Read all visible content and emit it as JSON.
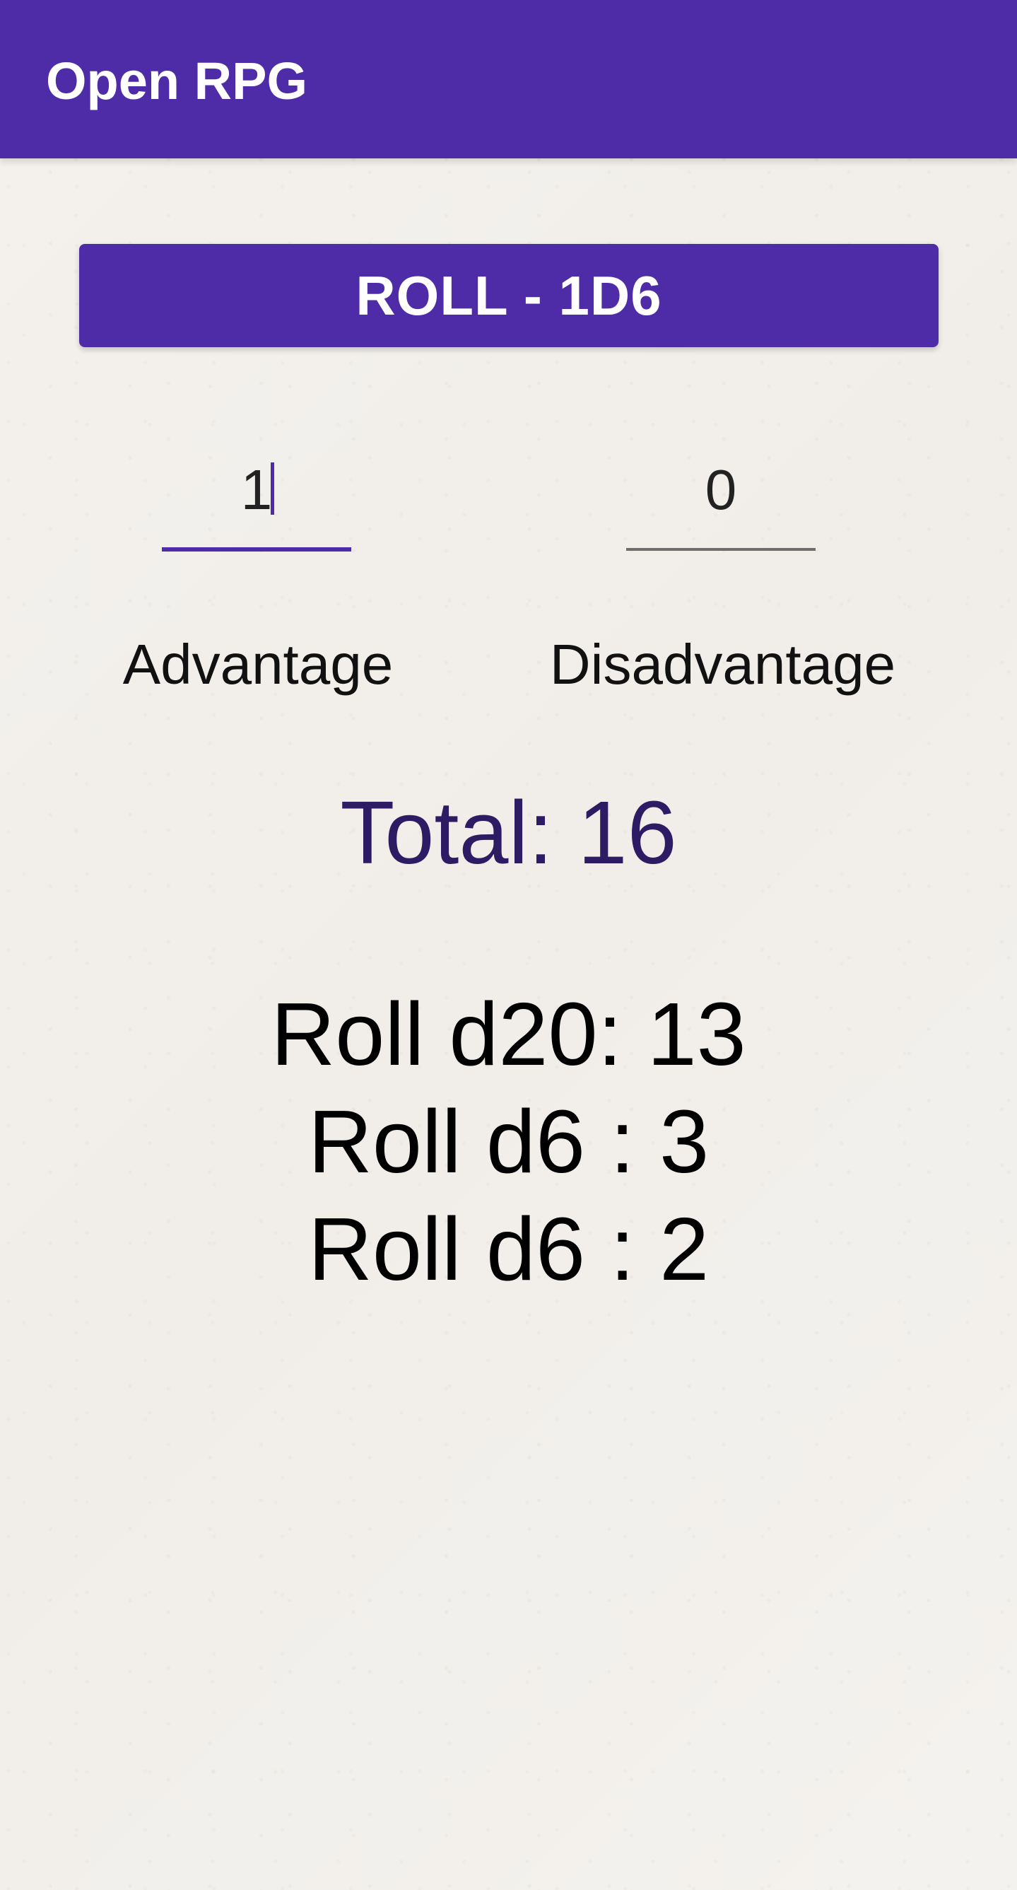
{
  "app_bar": {
    "title": "Open RPG"
  },
  "roll_button": {
    "label": "ROLL - 1D6"
  },
  "advantage": {
    "value": "1",
    "label": "Advantage"
  },
  "disadvantage": {
    "value": "0",
    "label": "Disadvantage"
  },
  "total_text": "Total: 16",
  "results": [
    "Roll d20: 13",
    "Roll d6 : 3",
    "Roll d6 : 2"
  ],
  "colors": {
    "primary": "#4f2ca7",
    "total_text": "#2d1b63",
    "background": "#f3f0ec"
  }
}
